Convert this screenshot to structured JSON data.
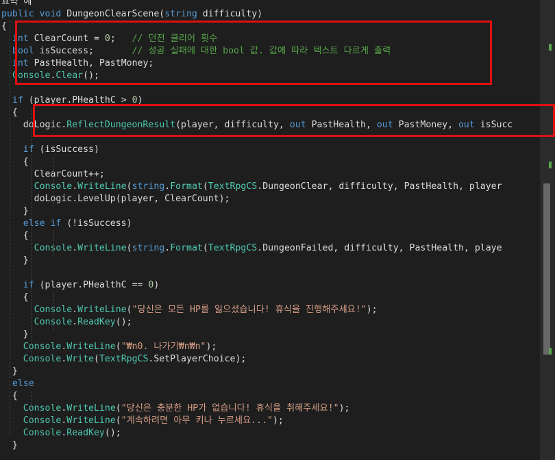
{
  "lines": [
    {
      "tokens": [
        {
          "c": "pl",
          "t": "요약 예"
        }
      ]
    },
    {
      "tokens": [
        {
          "c": "kw",
          "t": "public void "
        },
        {
          "c": "pl",
          "t": "DungeonClearScene("
        },
        {
          "c": "kw",
          "t": "string"
        },
        {
          "c": "pl",
          "t": " difficulty)"
        }
      ]
    },
    {
      "tokens": [
        {
          "c": "pl",
          "t": "{"
        }
      ]
    },
    {
      "tokens": [
        {
          "c": "pl",
          "t": "  "
        },
        {
          "c": "kw",
          "t": "int"
        },
        {
          "c": "pl",
          "t": " ClearCount = "
        },
        {
          "c": "nu",
          "t": "0"
        },
        {
          "c": "pl",
          "t": ";   "
        },
        {
          "c": "cm",
          "t": "// 던전 클리어 횟수"
        }
      ]
    },
    {
      "tokens": [
        {
          "c": "pl",
          "t": "  "
        },
        {
          "c": "kw",
          "t": "bool"
        },
        {
          "c": "pl",
          "t": " isSuccess;       "
        },
        {
          "c": "cm",
          "t": "// 성공 실패에 대한 bool 값. 값에 따라 텍스트 다르게 출력"
        }
      ]
    },
    {
      "tokens": [
        {
          "c": "pl",
          "t": "  "
        },
        {
          "c": "kw",
          "t": "int"
        },
        {
          "c": "pl",
          "t": " PastHealth, PastMoney;"
        }
      ]
    },
    {
      "tokens": [
        {
          "c": "pl",
          "t": "  "
        },
        {
          "c": "ty",
          "t": "Console"
        },
        {
          "c": "pl",
          "t": "."
        },
        {
          "c": "ty",
          "t": "Clear"
        },
        {
          "c": "pl",
          "t": "();"
        }
      ]
    },
    {
      "tokens": [
        {
          "c": "pl",
          "t": ""
        }
      ]
    },
    {
      "tokens": [
        {
          "c": "pl",
          "t": "  "
        },
        {
          "c": "kw",
          "t": "if"
        },
        {
          "c": "pl",
          "t": " (player.PHealthC > "
        },
        {
          "c": "nu",
          "t": "0"
        },
        {
          "c": "pl",
          "t": ")"
        }
      ]
    },
    {
      "tokens": [
        {
          "c": "pl",
          "t": "  {"
        }
      ]
    },
    {
      "tokens": [
        {
          "c": "pl",
          "t": "    doLogic."
        },
        {
          "c": "ty",
          "t": "ReflectDungeonResult"
        },
        {
          "c": "pl",
          "t": "(player, difficulty, "
        },
        {
          "c": "kw",
          "t": "out"
        },
        {
          "c": "pl",
          "t": " PastHealth, "
        },
        {
          "c": "kw",
          "t": "out"
        },
        {
          "c": "pl",
          "t": " PastMoney, "
        },
        {
          "c": "kw",
          "t": "out"
        },
        {
          "c": "pl",
          "t": " isSucc"
        }
      ]
    },
    {
      "tokens": [
        {
          "c": "pl",
          "t": ""
        }
      ]
    },
    {
      "tokens": [
        {
          "c": "pl",
          "t": "    "
        },
        {
          "c": "kw",
          "t": "if"
        },
        {
          "c": "pl",
          "t": " (isSuccess)"
        }
      ]
    },
    {
      "tokens": [
        {
          "c": "pl",
          "t": "    {"
        }
      ]
    },
    {
      "tokens": [
        {
          "c": "pl",
          "t": "      ClearCount++;"
        }
      ]
    },
    {
      "tokens": [
        {
          "c": "pl",
          "t": "      "
        },
        {
          "c": "ty",
          "t": "Console"
        },
        {
          "c": "pl",
          "t": "."
        },
        {
          "c": "ty",
          "t": "WriteLine"
        },
        {
          "c": "pl",
          "t": "("
        },
        {
          "c": "kw",
          "t": "string"
        },
        {
          "c": "pl",
          "t": "."
        },
        {
          "c": "ty",
          "t": "Format"
        },
        {
          "c": "pl",
          "t": "("
        },
        {
          "c": "ty",
          "t": "TextRpgCS"
        },
        {
          "c": "pl",
          "t": ".DungeonClear, difficulty, PastHealth, player"
        }
      ]
    },
    {
      "tokens": [
        {
          "c": "pl",
          "t": "      doLogic.LevelUp(player, ClearCount);"
        }
      ]
    },
    {
      "tokens": [
        {
          "c": "pl",
          "t": "    }"
        }
      ]
    },
    {
      "tokens": [
        {
          "c": "pl",
          "t": "    "
        },
        {
          "c": "kw",
          "t": "else if"
        },
        {
          "c": "pl",
          "t": " (!isSuccess)"
        }
      ]
    },
    {
      "tokens": [
        {
          "c": "pl",
          "t": "    {"
        }
      ]
    },
    {
      "tokens": [
        {
          "c": "pl",
          "t": "      "
        },
        {
          "c": "ty",
          "t": "Console"
        },
        {
          "c": "pl",
          "t": "."
        },
        {
          "c": "ty",
          "t": "WriteLine"
        },
        {
          "c": "pl",
          "t": "("
        },
        {
          "c": "kw",
          "t": "string"
        },
        {
          "c": "pl",
          "t": "."
        },
        {
          "c": "ty",
          "t": "Format"
        },
        {
          "c": "pl",
          "t": "("
        },
        {
          "c": "ty",
          "t": "TextRpgCS"
        },
        {
          "c": "pl",
          "t": ".DungeonFailed, difficulty, PastHealth, playe"
        }
      ]
    },
    {
      "tokens": [
        {
          "c": "pl",
          "t": "    }"
        }
      ]
    },
    {
      "tokens": [
        {
          "c": "pl",
          "t": ""
        }
      ]
    },
    {
      "tokens": [
        {
          "c": "pl",
          "t": "    "
        },
        {
          "c": "kw",
          "t": "if"
        },
        {
          "c": "pl",
          "t": " (player.PHealthC == "
        },
        {
          "c": "nu",
          "t": "0"
        },
        {
          "c": "pl",
          "t": ")"
        }
      ]
    },
    {
      "tokens": [
        {
          "c": "pl",
          "t": "    {"
        }
      ]
    },
    {
      "tokens": [
        {
          "c": "pl",
          "t": "      "
        },
        {
          "c": "ty",
          "t": "Console"
        },
        {
          "c": "pl",
          "t": "."
        },
        {
          "c": "ty",
          "t": "WriteLine"
        },
        {
          "c": "pl",
          "t": "("
        },
        {
          "c": "st",
          "t": "\"당신은 모든 HP를 잃으셨습니다! 휴식을 진행해주세요!\""
        },
        {
          "c": "pl",
          "t": ");"
        }
      ]
    },
    {
      "tokens": [
        {
          "c": "pl",
          "t": "      "
        },
        {
          "c": "ty",
          "t": "Console"
        },
        {
          "c": "pl",
          "t": "."
        },
        {
          "c": "ty",
          "t": "ReadKey"
        },
        {
          "c": "pl",
          "t": "();"
        }
      ]
    },
    {
      "tokens": [
        {
          "c": "pl",
          "t": "    }"
        }
      ]
    },
    {
      "tokens": [
        {
          "c": "pl",
          "t": "    "
        },
        {
          "c": "ty",
          "t": "Console"
        },
        {
          "c": "pl",
          "t": "."
        },
        {
          "c": "ty",
          "t": "WriteLine"
        },
        {
          "c": "pl",
          "t": "("
        },
        {
          "c": "st",
          "t": "\"₩n0. 나가기₩n₩n\""
        },
        {
          "c": "pl",
          "t": ");"
        }
      ]
    },
    {
      "tokens": [
        {
          "c": "pl",
          "t": "    "
        },
        {
          "c": "ty",
          "t": "Console"
        },
        {
          "c": "pl",
          "t": "."
        },
        {
          "c": "ty",
          "t": "Write"
        },
        {
          "c": "pl",
          "t": "("
        },
        {
          "c": "ty",
          "t": "TextRpgCS"
        },
        {
          "c": "pl",
          "t": ".SetPlayerChoice);"
        }
      ]
    },
    {
      "tokens": [
        {
          "c": "pl",
          "t": "  }"
        }
      ]
    },
    {
      "tokens": [
        {
          "c": "pl",
          "t": "  "
        },
        {
          "c": "kw",
          "t": "else"
        }
      ]
    },
    {
      "tokens": [
        {
          "c": "pl",
          "t": "  {"
        }
      ]
    },
    {
      "tokens": [
        {
          "c": "pl",
          "t": "    "
        },
        {
          "c": "ty",
          "t": "Console"
        },
        {
          "c": "pl",
          "t": "."
        },
        {
          "c": "ty",
          "t": "WriteLine"
        },
        {
          "c": "pl",
          "t": "("
        },
        {
          "c": "st",
          "t": "\"당신은 충분한 HP가 없습니다! 휴식을 취해주세요!\""
        },
        {
          "c": "pl",
          "t": ");"
        }
      ]
    },
    {
      "tokens": [
        {
          "c": "pl",
          "t": "    "
        },
        {
          "c": "ty",
          "t": "Console"
        },
        {
          "c": "pl",
          "t": "."
        },
        {
          "c": "ty",
          "t": "WriteLine"
        },
        {
          "c": "pl",
          "t": "("
        },
        {
          "c": "st",
          "t": "\"계속하려면 아무 키나 누르세요...\""
        },
        {
          "c": "pl",
          "t": ");"
        }
      ]
    },
    {
      "tokens": [
        {
          "c": "pl",
          "t": "    "
        },
        {
          "c": "ty",
          "t": "Console"
        },
        {
          "c": "pl",
          "t": "."
        },
        {
          "c": "ty",
          "t": "ReadKey"
        },
        {
          "c": "pl",
          "t": "();"
        }
      ]
    },
    {
      "tokens": [
        {
          "c": "pl",
          "t": "  }"
        }
      ]
    }
  ],
  "colors": {
    "background": "#1e1e1e",
    "highlight_box": "#e01010",
    "keyword": "#569cd6",
    "type": "#4ec9b0",
    "string": "#d69d85",
    "comment": "#57a64a"
  }
}
